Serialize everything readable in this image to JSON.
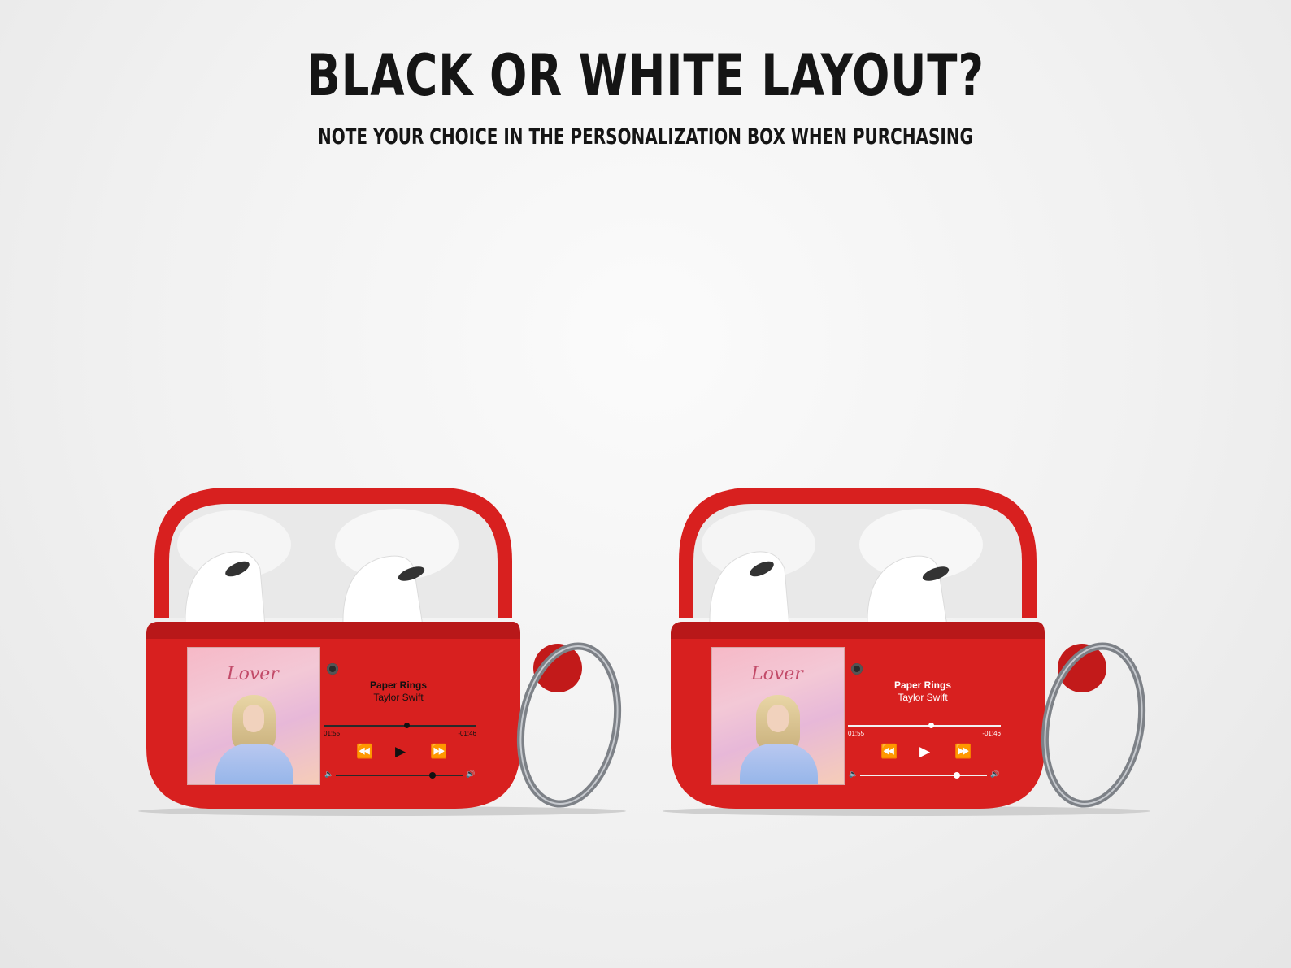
{
  "heading": {
    "title": "BLACK OR WHITE LAYOUT?",
    "subtitle": "NOTE YOUR CHOICE IN THE PERSONALIZATION BOX WHEN PURCHASING"
  },
  "colors": {
    "case_red": "#d8201f",
    "case_dark_red": "#a91415",
    "inner_white": "#f2f2f2",
    "ring_metal": "#7d8187"
  },
  "cases": [
    {
      "layout": "black",
      "album_title": "Lover",
      "song": "Paper Rings",
      "artist": "Taylor Swift",
      "time_elapsed": "01:55",
      "time_remaining": "-01:46",
      "progress": 0.54,
      "volume": 0.76,
      "icons": [
        "rewind-icon",
        "play-icon",
        "fast-forward-icon",
        "volume-low-icon",
        "volume-high-icon"
      ]
    },
    {
      "layout": "white",
      "album_title": "Lover",
      "song": "Paper Rings",
      "artist": "Taylor Swift",
      "time_elapsed": "01:55",
      "time_remaining": "-01:46",
      "progress": 0.54,
      "volume": 0.76,
      "icons": [
        "rewind-icon",
        "play-icon",
        "fast-forward-icon",
        "volume-low-icon",
        "volume-high-icon"
      ]
    }
  ]
}
